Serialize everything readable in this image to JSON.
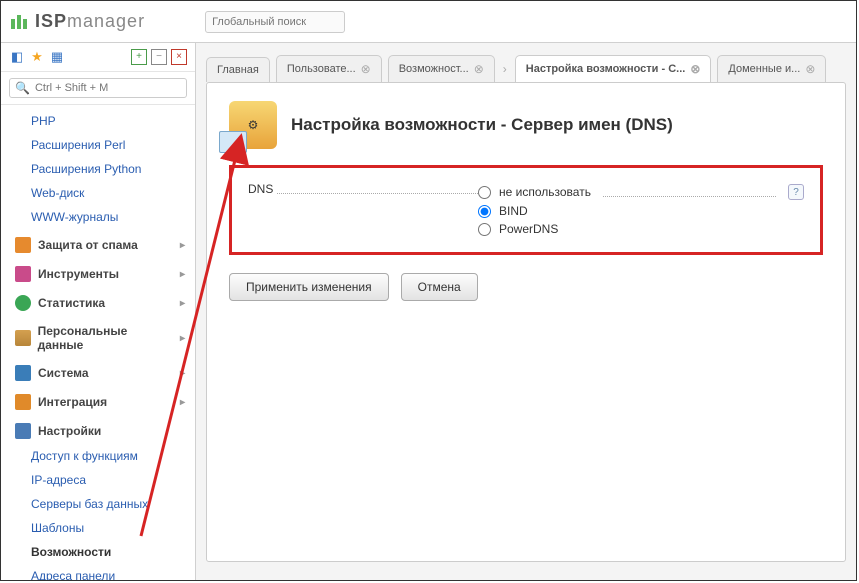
{
  "logo": {
    "text_isp": "ISP",
    "text_manager": "manager"
  },
  "global_search": {
    "placeholder": "Глобальный поиск"
  },
  "quick_search": {
    "placeholder": "Ctrl + Shift + M"
  },
  "sidebar": {
    "items_top": [
      {
        "label": "PHP"
      },
      {
        "label": "Расширения Perl"
      },
      {
        "label": "Расширения Python"
      },
      {
        "label": "Web-диск"
      },
      {
        "label": "WWW-журналы"
      }
    ],
    "cats": [
      {
        "label": "Защита от спама",
        "icon_color": "#e68a2e"
      },
      {
        "label": "Инструменты",
        "icon_color": "#c94b8a"
      },
      {
        "label": "Статистика",
        "icon_color": "#3aa655"
      },
      {
        "label": "Персональные данные",
        "icon_color": "#b8863a"
      },
      {
        "label": "Система",
        "icon_color": "#3a7db8"
      },
      {
        "label": "Интеграция",
        "icon_color": "#e08a2a"
      }
    ],
    "settings_cat": {
      "label": "Настройки",
      "icon_color": "#4a7bb5"
    },
    "settings_items": [
      {
        "label": "Доступ к функциям"
      },
      {
        "label": "IP-адреса"
      },
      {
        "label": "Серверы баз данных"
      },
      {
        "label": "Шаблоны"
      },
      {
        "label": "Возможности",
        "active": true
      },
      {
        "label": "Адреса панели"
      }
    ]
  },
  "tabs": [
    {
      "label": "Главная",
      "closable": false
    },
    {
      "label": "Пользовате...",
      "closable": true
    },
    {
      "label": "Возможност...",
      "closable": true
    },
    {
      "label": "Настройка возможности - С...",
      "closable": true,
      "active": true
    },
    {
      "label": "Доменные и...",
      "closable": true
    }
  ],
  "page": {
    "title": "Настройка возможности - Сервер имен (DNS)",
    "field_label": "DNS",
    "options": [
      {
        "label": "не использовать",
        "checked": false,
        "help": true
      },
      {
        "label": "BIND",
        "checked": true
      },
      {
        "label": "PowerDNS",
        "checked": false
      }
    ],
    "apply": "Применить изменения",
    "cancel": "Отмена"
  }
}
